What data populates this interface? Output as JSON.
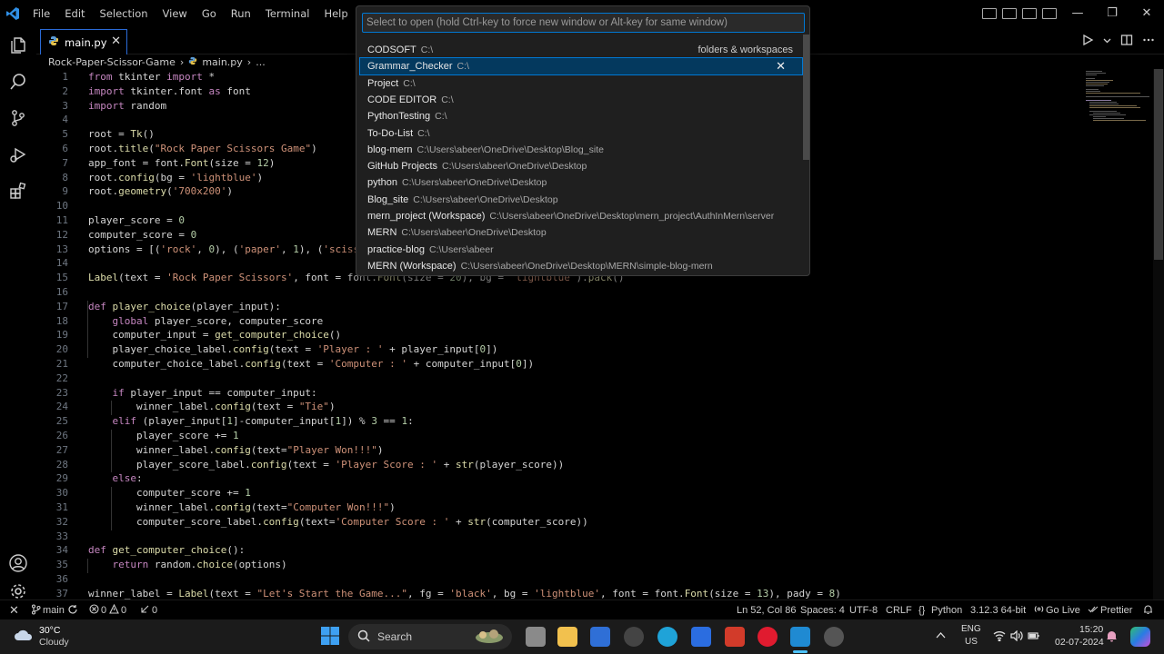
{
  "menu": [
    "File",
    "Edit",
    "Selection",
    "View",
    "Go",
    "Run",
    "Terminal",
    "Help"
  ],
  "window_controls": [
    "—",
    "❐",
    "✕"
  ],
  "tab": {
    "label": "main.py",
    "close": "✕"
  },
  "breadcrumb": {
    "folder": "Rock-Paper-Scissor-Game",
    "sep": "›",
    "file": "main.py",
    "sep2": "›",
    "more": "..."
  },
  "quick_open": {
    "placeholder": "Select to open (hold Ctrl-key to force new window or Alt-key for same window)",
    "category": "folders & workspaces",
    "remove": "✕",
    "items": [
      {
        "label": "CODSOFT",
        "desc": "C:\\"
      },
      {
        "label": "Grammar_Checker",
        "desc": "C:\\"
      },
      {
        "label": "Project",
        "desc": "C:\\"
      },
      {
        "label": "CODE EDITOR",
        "desc": "C:\\"
      },
      {
        "label": "PythonTesting",
        "desc": "C:\\"
      },
      {
        "label": "To-Do-List",
        "desc": "C:\\"
      },
      {
        "label": "blog-mern",
        "desc": "C:\\Users\\abeer\\OneDrive\\Desktop\\Blog_site"
      },
      {
        "label": "GitHub Projects",
        "desc": "C:\\Users\\abeer\\OneDrive\\Desktop"
      },
      {
        "label": "python",
        "desc": "C:\\Users\\abeer\\OneDrive\\Desktop"
      },
      {
        "label": "Blog_site",
        "desc": "C:\\Users\\abeer\\OneDrive\\Desktop"
      },
      {
        "label": "mern_project (Workspace)",
        "desc": "C:\\Users\\abeer\\OneDrive\\Desktop\\mern_project\\AuthInMern\\server"
      },
      {
        "label": "MERN",
        "desc": "C:\\Users\\abeer\\OneDrive\\Desktop"
      },
      {
        "label": "practice-blog",
        "desc": "C:\\Users\\abeer"
      },
      {
        "label": "MERN (Workspace)",
        "desc": "C:\\Users\\abeer\\OneDrive\\Desktop\\MERN\\simple-blog-mern"
      }
    ]
  },
  "code_lines": [
    {
      "n": "1",
      "t": "from tkinter import *"
    },
    {
      "n": "2",
      "t": "import tkinter.font as font"
    },
    {
      "n": "3",
      "t": "import random"
    },
    {
      "n": "4",
      "t": ""
    },
    {
      "n": "5",
      "t": "root = Tk()"
    },
    {
      "n": "6",
      "t": "root.title(\"Rock Paper Scissors Game\")"
    },
    {
      "n": "7",
      "t": "app_font = font.Font(size = 12)"
    },
    {
      "n": "8",
      "t": "root.config(bg = 'lightblue')"
    },
    {
      "n": "9",
      "t": "root.geometry('700x200')"
    },
    {
      "n": "10",
      "t": ""
    },
    {
      "n": "11",
      "t": "player_score = 0"
    },
    {
      "n": "12",
      "t": "computer_score = 0"
    },
    {
      "n": "13",
      "t": "options = [('rock', 0), ('paper', 1), ('scisso"
    },
    {
      "n": "14",
      "t": ""
    },
    {
      "n": "15",
      "t": "Label(text = 'Rock Paper Scissors', font = font.Font(size = 20), bg = 'lightblue').pack()"
    },
    {
      "n": "16",
      "t": ""
    },
    {
      "n": "17",
      "t": "def player_choice(player_input):"
    },
    {
      "n": "18",
      "t": "    global player_score, computer_score"
    },
    {
      "n": "19",
      "t": "    computer_input = get_computer_choice()"
    },
    {
      "n": "20",
      "t": "    player_choice_label.config(text = 'Player : ' + player_input[0])"
    },
    {
      "n": "21",
      "t": "    computer_choice_label.config(text = 'Computer : ' + computer_input[0])"
    },
    {
      "n": "22",
      "t": ""
    },
    {
      "n": "23",
      "t": "    if player_input == computer_input:"
    },
    {
      "n": "24",
      "t": "        winner_label.config(text = \"Tie\")"
    },
    {
      "n": "25",
      "t": "    elif (player_input[1]-computer_input[1]) % 3 == 1:"
    },
    {
      "n": "26",
      "t": "        player_score += 1"
    },
    {
      "n": "27",
      "t": "        winner_label.config(text=\"Player Won!!!\")"
    },
    {
      "n": "28",
      "t": "        player_score_label.config(text = 'Player Score : ' + str(player_score))"
    },
    {
      "n": "29",
      "t": "    else:"
    },
    {
      "n": "30",
      "t": "        computer_score += 1"
    },
    {
      "n": "31",
      "t": "        winner_label.config(text=\"Computer Won!!!\")"
    },
    {
      "n": "32",
      "t": "        computer_score_label.config(text='Computer Score : ' + str(computer_score))"
    },
    {
      "n": "33",
      "t": ""
    },
    {
      "n": "34",
      "t": "def get_computer_choice():"
    },
    {
      "n": "35",
      "t": "    return random.choice(options)"
    },
    {
      "n": "36",
      "t": ""
    },
    {
      "n": "37",
      "t": "winner_label = Label(text = \"Let's Start the Game...\", fg = 'black', bg = 'lightblue', font = font.Font(size = 13), pady = 8)"
    }
  ],
  "status": {
    "remote": "✕",
    "branch": "main",
    "problems_errors": "0",
    "problems_warnings": "0",
    "ports": "0",
    "cursor": "Ln 52, Col 86",
    "spaces": "Spaces: 4",
    "encoding": "UTF-8",
    "eol": "CRLF",
    "language": "Python",
    "interpreter": "3.12.3 64-bit",
    "golive": "Go Live",
    "prettier": "Prettier"
  },
  "taskbar": {
    "weather_temp": "30°C",
    "weather_desc": "Cloudy",
    "search_label": "Search",
    "lang_1": "ENG",
    "lang_2": "US",
    "time": "15:20",
    "date": "02-07-2024"
  },
  "colors": {
    "accent": "#0078d4",
    "selection": "#04395e",
    "keyword": "#c586c0",
    "function": "#dcdcaa",
    "string": "#ce9178",
    "variable": "#9cdcfe",
    "number": "#b5cea8"
  }
}
